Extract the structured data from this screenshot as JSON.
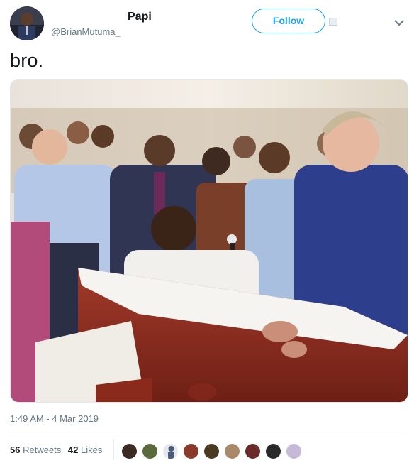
{
  "tweet": {
    "display_name": "Papi",
    "handle": "@BrianMutuma_",
    "follow_label": "Follow",
    "text": "bro.",
    "timestamp": "1:49 AM - 4 Mar 2019"
  },
  "stats": {
    "retweets_count": "56",
    "retweets_label": "Retweets",
    "likes_count": "42",
    "likes_label": "Likes"
  },
  "icons": {
    "more": "chevron-down-icon"
  },
  "colors": {
    "accent": "#1da1f2",
    "muted": "#657786",
    "text": "#14171a"
  }
}
